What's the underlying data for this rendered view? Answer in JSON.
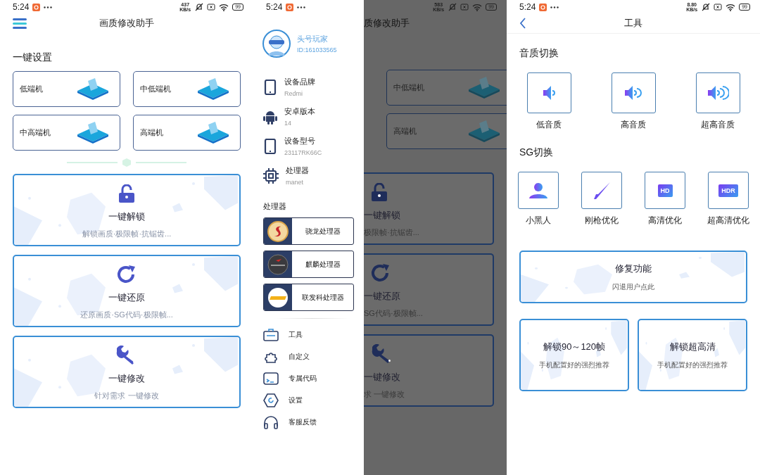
{
  "main_screen": {
    "status_bar": {
      "time": "5:24",
      "speed_value": "437",
      "speed_unit": "KB/s",
      "battery": "99"
    },
    "title": "画质修改助手",
    "section_title": "一键设置",
    "tiers": [
      "低端机",
      "中低端机",
      "中高端机",
      "高端机"
    ],
    "actions": [
      {
        "title": "一键解锁",
        "subtitle": "解锁画质·极限帧·抗锯齿..."
      },
      {
        "title": "一键还原",
        "subtitle": "还原画质·SG代码·极限帧..."
      },
      {
        "title": "一键修改",
        "subtitle": "针对需求 一键修改"
      }
    ]
  },
  "drawer_screen": {
    "status_bar": {
      "time": "5:24",
      "speed_value": "583",
      "speed_unit": "KB/s",
      "battery": "99"
    },
    "drawer": {
      "user": {
        "name": "头号玩家",
        "id": "ID:161033565"
      },
      "device_info": [
        {
          "label": "设备品牌",
          "value": "Redmi"
        },
        {
          "label": "安卓版本",
          "value": "14"
        },
        {
          "label": "设备型号",
          "value": "23117RK66C"
        },
        {
          "label": "处理器",
          "value": "manet"
        }
      ],
      "processor_heading": "处理器",
      "processors": [
        "骁龙处理器",
        "麒麟处理器",
        "联发科处理器"
      ],
      "menu": [
        "工具",
        "自定义",
        "专属代码",
        "设置",
        "客服反馈"
      ]
    },
    "backdrop": {
      "title": "质修改助手",
      "tiers": [
        "中低端机",
        "高端机"
      ],
      "actions": [
        {
          "title": "一键解锁",
          "subtitle": "极限帧·抗锯齿..."
        },
        {
          "title": "一键还原",
          "subtitle": "SG代码·极限帧..."
        },
        {
          "title": "一键修改",
          "subtitle": "求 一键修改"
        }
      ]
    }
  },
  "tools_screen": {
    "status_bar": {
      "time": "5:24",
      "speed_value": "8.80",
      "speed_unit": "KB/s",
      "battery": "99"
    },
    "title": "工具",
    "audio_section": "音质切换",
    "audio_options": [
      "低音质",
      "高音质",
      "超高音质"
    ],
    "sg_section": "SG切换",
    "sg_options": [
      {
        "kind": "person",
        "label": "小黑人"
      },
      {
        "kind": "rifle",
        "label": "刚枪优化"
      },
      {
        "kind": "badge",
        "badge": "HD",
        "label": "高清优化"
      },
      {
        "kind": "badge",
        "badge": "HDR",
        "label": "超高清优化"
      }
    ],
    "repair": {
      "title": "修复功能",
      "subtitle": "闪退用户点此"
    },
    "unlock_cards": [
      {
        "title": "解锁90～120帧",
        "subtitle": "手机配置好的强烈推荐"
      },
      {
        "title": "解锁超高清",
        "subtitle": "手机配置好的强烈推荐"
      }
    ]
  }
}
